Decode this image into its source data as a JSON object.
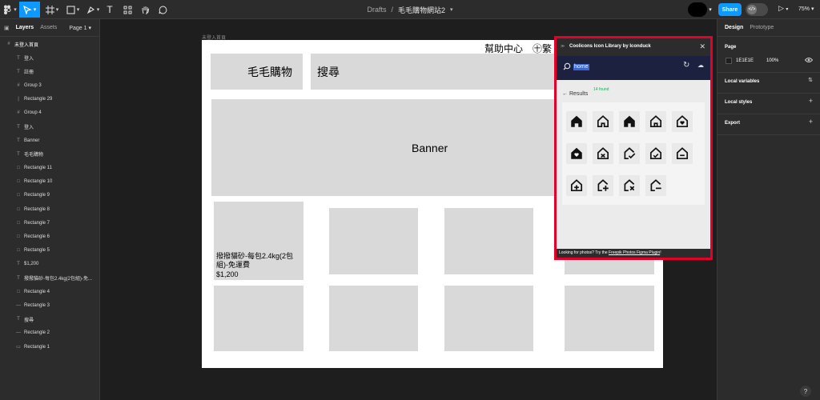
{
  "toolbar": {
    "main_menu_icon": "figma-logo-icon",
    "tools": [
      "move-tool-icon",
      "frame-tool-icon",
      "shape-tool-icon",
      "pen-tool-icon",
      "text-tool-icon",
      "resources-icon",
      "hand-tool-icon",
      "comment-icon"
    ],
    "text_tool_glyph": "T",
    "breadcrumb_drafts": "Drafts",
    "breadcrumb_sep": "/",
    "file_name": "毛毛購物網站2",
    "share_label": "Share",
    "zoom_level": "75%"
  },
  "layers_panel": {
    "tab_layers": "Layers",
    "tab_assets": "Assets",
    "page_selector": "Page 1",
    "top_frame": "未登入首頁",
    "items": [
      {
        "icon": "T",
        "label": "登入"
      },
      {
        "icon": "T",
        "label": "註冊"
      },
      {
        "icon": "#",
        "label": "Group 3"
      },
      {
        "icon": "|",
        "label": "Rectangle 29"
      },
      {
        "icon": "#",
        "label": "Group 4"
      },
      {
        "icon": "T",
        "label": "登入"
      },
      {
        "icon": "T",
        "label": "Banner"
      },
      {
        "icon": "T",
        "label": "毛毛購物"
      },
      {
        "icon": "□",
        "label": "Rectangle 11"
      },
      {
        "icon": "□",
        "label": "Rectangle 10"
      },
      {
        "icon": "□",
        "label": "Rectangle 9"
      },
      {
        "icon": "□",
        "label": "Rectangle 8"
      },
      {
        "icon": "□",
        "label": "Rectangle 7"
      },
      {
        "icon": "□",
        "label": "Rectangle 6"
      },
      {
        "icon": "□",
        "label": "Rectangle 5"
      },
      {
        "icon": "T",
        "label": "$1,200"
      },
      {
        "icon": "T",
        "label": "撥撥貓砂-每包2.4kg(2包組)-免..."
      },
      {
        "icon": "□",
        "label": "Rectangle 4"
      },
      {
        "icon": "—",
        "label": "Rectangle 3"
      },
      {
        "icon": "T",
        "label": "搜尋"
      },
      {
        "icon": "—",
        "label": "Rectangle 2"
      },
      {
        "icon": "▭",
        "label": "Rectangle 1"
      }
    ]
  },
  "canvas": {
    "frame_label": "未登入首頁",
    "logo_text": "毛毛購物",
    "search_text": "搜尋",
    "help_center": "幫助中心",
    "language": "㊉繁",
    "banner_text": "Banner",
    "product_name": "撥撥貓砂-每包2.4kg(2包組)-免運費",
    "product_price": "$1,200"
  },
  "plugin": {
    "logo": "≫",
    "title": "Coolicons Icon Library by Iconduck",
    "close_glyph": "✕",
    "search_value": "home",
    "search_icon": "magnifier-icon",
    "refresh_glyph": "↻",
    "cloud_glyph": "☁",
    "back_glyph": "←",
    "results_label": "Results",
    "found_count": "14 found",
    "icons": [
      "home-filled-icon",
      "home-outline-icon",
      "home-filled-door-icon",
      "home-door-icon",
      "home-heart-icon",
      "home-heart-filled-icon",
      "home-close-icon",
      "home-check-open-icon",
      "home-check-icon",
      "home-minus-icon",
      "home-plus-icon",
      "home-plus-open-icon",
      "home-close-open-icon",
      "home-minus-open-icon"
    ],
    "footer_prefix": "Looking for photos? Try the ",
    "footer_link": "Freepik Photos Figma Plugin",
    "footer_suffix": "!"
  },
  "design_panel": {
    "tab_design": "Design",
    "tab_prototype": "Prototype",
    "page_heading": "Page",
    "page_color": "1E1E1E",
    "page_opacity": "100%",
    "local_variables": "Local variables",
    "local_styles": "Local styles",
    "export": "Export",
    "plus_glyph": "+",
    "help_glyph": "?"
  }
}
